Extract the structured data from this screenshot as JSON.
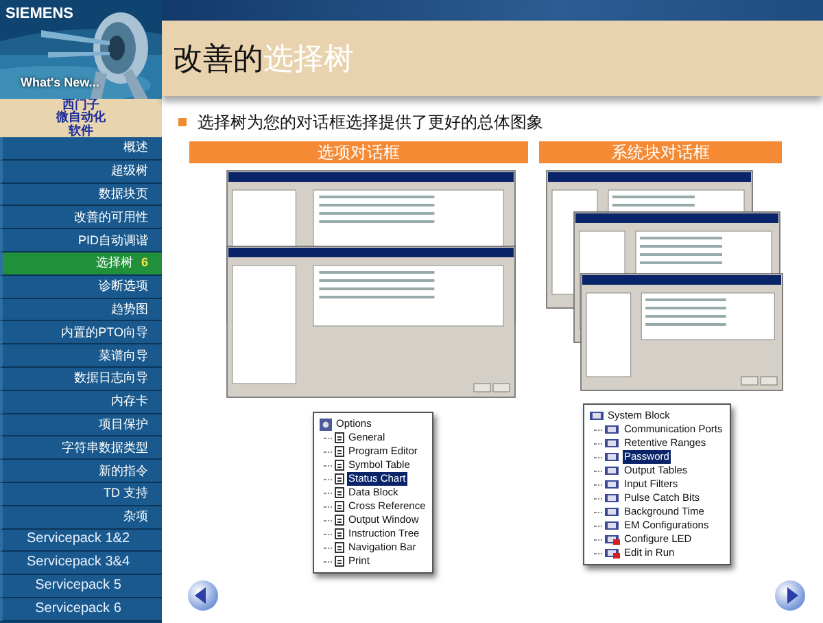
{
  "header": {
    "brand": "SIEMENS",
    "tagline": "What's New..."
  },
  "product": [
    "西门子",
    "微自动化",
    "软件"
  ],
  "menu": [
    {
      "label": "概述",
      "kind": "topic",
      "selected": false
    },
    {
      "label": "超级树",
      "kind": "topic",
      "selected": false
    },
    {
      "label": "数据块页",
      "kind": "topic",
      "selected": false
    },
    {
      "label": "改善的可用性",
      "kind": "topic",
      "selected": false
    },
    {
      "label": "PID自动调谐",
      "kind": "topic",
      "selected": false
    },
    {
      "label": "选择树",
      "badge": "6",
      "kind": "topic",
      "selected": true
    },
    {
      "label": "诊断选项",
      "kind": "topic",
      "selected": false
    },
    {
      "label": "趋势图",
      "kind": "topic",
      "selected": false
    },
    {
      "label": "内置的PTO向导",
      "kind": "topic",
      "selected": false
    },
    {
      "label": "菜谱向导",
      "kind": "topic",
      "selected": false
    },
    {
      "label": "数据日志向导",
      "kind": "topic",
      "selected": false
    },
    {
      "label": "内存卡",
      "kind": "topic",
      "selected": false
    },
    {
      "label": "项目保护",
      "kind": "topic",
      "selected": false
    },
    {
      "label": "字符串数据类型",
      "kind": "topic",
      "selected": false
    },
    {
      "label": "新的指令",
      "kind": "topic",
      "selected": false
    },
    {
      "label": "TD 支持",
      "kind": "topic",
      "selected": false
    },
    {
      "label": "杂项",
      "kind": "topic",
      "selected": false
    },
    {
      "label": "Servicepack 1&2",
      "kind": "servicepack",
      "selected": false
    },
    {
      "label": "Servicepack 3&4",
      "kind": "servicepack",
      "selected": false
    },
    {
      "label": "Servicepack 5",
      "kind": "servicepack",
      "selected": false
    },
    {
      "label": "Servicepack 6",
      "kind": "servicepack",
      "selected": false
    }
  ],
  "title": {
    "prefix": "改善的",
    "highlight": "选择树"
  },
  "bullet": "选择树为您的对话框选择提供了更好的总体图象",
  "panels": [
    {
      "heading": "选项对话框",
      "kind": "options",
      "tree": {
        "root": "Options",
        "items": [
          {
            "label": "General",
            "selected": false
          },
          {
            "label": "Program Editor",
            "selected": false
          },
          {
            "label": "Symbol Table",
            "selected": false
          },
          {
            "label": "Status Chart",
            "selected": true
          },
          {
            "label": "Data Block",
            "selected": false
          },
          {
            "label": "Cross Reference",
            "selected": false
          },
          {
            "label": "Output Window",
            "selected": false
          },
          {
            "label": "Instruction Tree",
            "selected": false
          },
          {
            "label": "Navigation Bar",
            "selected": false
          },
          {
            "label": "Print",
            "selected": false
          }
        ]
      }
    },
    {
      "heading": "系统块对话框",
      "kind": "system",
      "tree": {
        "root": "System Block",
        "items": [
          {
            "label": "Communication Ports",
            "selected": false,
            "flagged": false
          },
          {
            "label": "Retentive Ranges",
            "selected": false,
            "flagged": false
          },
          {
            "label": "Password",
            "selected": true,
            "flagged": false
          },
          {
            "label": "Output Tables",
            "selected": false,
            "flagged": false
          },
          {
            "label": "Input Filters",
            "selected": false,
            "flagged": false
          },
          {
            "label": "Pulse Catch Bits",
            "selected": false,
            "flagged": false
          },
          {
            "label": "Background Time",
            "selected": false,
            "flagged": false
          },
          {
            "label": "EM Configurations",
            "selected": false,
            "flagged": false
          },
          {
            "label": "Configure LED",
            "selected": false,
            "flagged": true
          },
          {
            "label": "Edit in Run",
            "selected": false,
            "flagged": true
          }
        ]
      }
    }
  ]
}
